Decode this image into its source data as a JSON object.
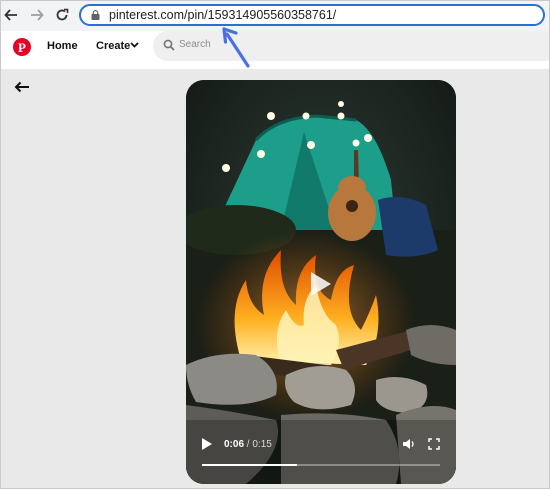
{
  "browser": {
    "url_host": "pinterest.com",
    "url_path": "/pin/159314905560358761/",
    "nav": {
      "back": "back-icon",
      "forward": "forward-icon",
      "reload": "reload-icon"
    }
  },
  "header": {
    "logo": "P",
    "home_label": "Home",
    "create_label": "Create",
    "search_placeholder": "Search"
  },
  "video": {
    "current_time": "0:06",
    "separator": "/",
    "duration": "0:15",
    "progress_fraction": 0.4
  },
  "colors": {
    "brand": "#e60023",
    "annotation_arrow": "#4a6fe3",
    "url_focus": "#2a6fd6"
  }
}
